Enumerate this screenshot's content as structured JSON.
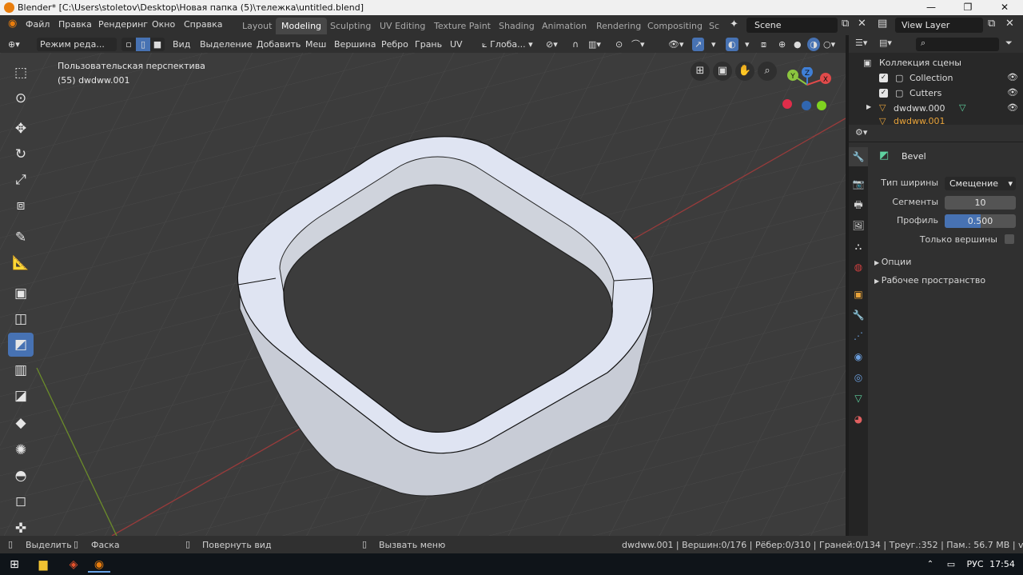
{
  "window": {
    "title": "Blender* [C:\\Users\\stoletov\\Desktop\\Новая папка (5)\\тележка\\untitled.blend]",
    "min": "—",
    "restore": "❐",
    "close": "✕"
  },
  "menu": {
    "items": [
      "Файл",
      "Правка",
      "Рендеринг",
      "Окно",
      "Справка"
    ]
  },
  "workspaces": [
    "Layout",
    "Modeling",
    "Sculpting",
    "UV Editing",
    "Texture Paint",
    "Shading",
    "Animation",
    "Rendering",
    "Compositing",
    "Sc"
  ],
  "active_workspace": "Modeling",
  "scene": {
    "name": "Scene",
    "view_layer": "View Layer"
  },
  "header": {
    "mode": "Режим реда...",
    "menus": [
      "Вид",
      "Выделение",
      "Добавить",
      "Меш",
      "Вершина",
      "Ребро",
      "Грань",
      "UV"
    ],
    "transform_orientation": "Глоба..."
  },
  "viewport": {
    "perspective_label": "Пользовательская перспектива",
    "object_label": "(55) dwdww.001",
    "gizmo": {
      "x": "X",
      "y": "Y",
      "z": "Z"
    }
  },
  "toolbar": {
    "active_tool_index": 8
  },
  "outliner": {
    "search_placeholder": "",
    "collection_title": "Коллекция сцены",
    "rows": [
      {
        "label": "Collection"
      },
      {
        "label": "Cutters"
      },
      {
        "label": "dwdww.000"
      },
      {
        "label": "dwdww.001"
      }
    ]
  },
  "properties": {
    "panel_title": "Bevel",
    "width_type_label": "Тип ширины",
    "width_type_value": "Смещение",
    "segments_label": "Сегменты",
    "segments_value": "10",
    "profile_label": "Профиль",
    "profile_value": "0.500",
    "profile_fraction": 0.5,
    "vertices_only_label": "Только вершины",
    "options_label": "Опции",
    "workspace_label": "Рабочее пространство"
  },
  "status": {
    "select": "Выделить",
    "box": "Фаска",
    "rotate": "Повернуть вид",
    "menu": "Вызвать меню",
    "stats": "dwdww.001 | Вершин:0/176 | Рёбер:0/310 | Граней:0/134 | Треуг.:352 | Пам.: 56.7 MB | v2.80.74"
  },
  "taskbar": {
    "lang": "РУС",
    "time": "17:54"
  },
  "colors": {
    "accent": "#4772b3",
    "selected_object": "#e8a33a",
    "x_axis": "#e04a4a",
    "y_axis": "#8cc63f",
    "z_axis": "#3f7fd6"
  }
}
